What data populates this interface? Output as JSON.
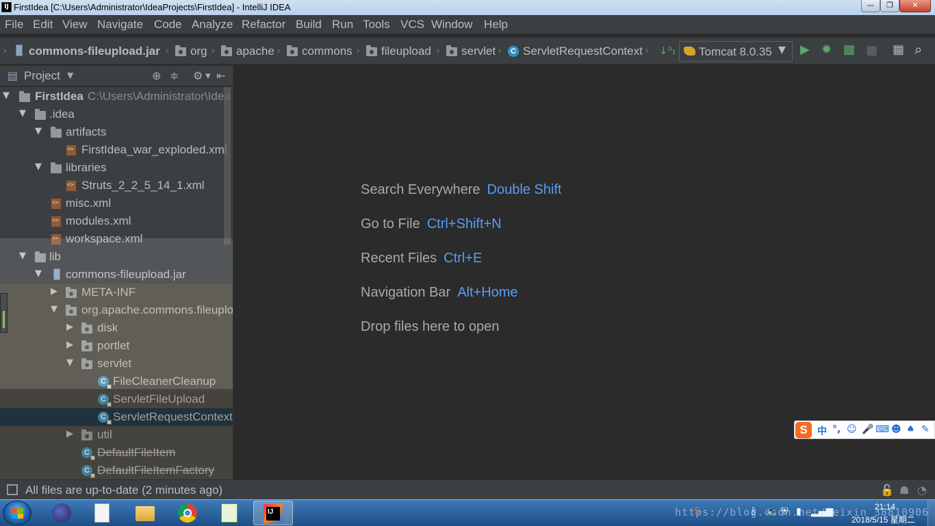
{
  "window": {
    "title": "FirstIdea [C:\\Users\\Administrator\\IdeaProjects\\FirstIdea] - IntelliJ IDEA",
    "app_icon": "IJ",
    "controls": {
      "minimize": "—",
      "maximize": "❐",
      "close": "✕"
    }
  },
  "menu": [
    "File",
    "Edit",
    "View",
    "Navigate",
    "Code",
    "Analyze",
    "Refactor",
    "Build",
    "Run",
    "Tools",
    "VCS",
    "Window",
    "Help"
  ],
  "breadcrumb": [
    "commons-fileupload.jar",
    "org",
    "apache",
    "commons",
    "fileupload",
    "servlet",
    "ServletRequestContext"
  ],
  "run_config": {
    "label": "Tomcat 8.0.35"
  },
  "project_panel": {
    "title": "Project",
    "tree": [
      {
        "label": "FirstIdea",
        "extra": "C:\\Users\\Administrator\\Idea",
        "icon": "project-folder-icon"
      },
      {
        "label": ".idea",
        "icon": "folder-icon"
      },
      {
        "label": "artifacts",
        "icon": "folder-icon"
      },
      {
        "label": "FirstIdea_war_exploded.xml",
        "icon": "xml-file-icon"
      },
      {
        "label": "libraries",
        "icon": "folder-icon"
      },
      {
        "label": "Struts_2_2_5_14_1.xml",
        "icon": "xml-file-icon"
      },
      {
        "label": "misc.xml",
        "icon": "xml-file-icon"
      },
      {
        "label": "modules.xml",
        "icon": "xml-file-icon"
      },
      {
        "label": "workspace.xml",
        "icon": "xml-file-icon"
      },
      {
        "label": "lib",
        "icon": "folder-icon"
      },
      {
        "label": "commons-fileupload.jar",
        "icon": "jar-icon"
      },
      {
        "label": "META-INF",
        "icon": "package-icon"
      },
      {
        "label": "org.apache.commons.fileuplo",
        "icon": "package-icon"
      },
      {
        "label": "disk",
        "icon": "package-icon"
      },
      {
        "label": "portlet",
        "icon": "package-icon"
      },
      {
        "label": "servlet",
        "icon": "package-icon"
      },
      {
        "label": "FileCleanerCleanup",
        "icon": "class-icon"
      },
      {
        "label": "ServletFileUpload",
        "icon": "class-icon"
      },
      {
        "label": "ServletRequestContext",
        "icon": "class-icon",
        "selected": true
      },
      {
        "label": "util",
        "icon": "package-icon"
      },
      {
        "label": "DefaultFileItem",
        "icon": "class-icon",
        "deprecated": true
      },
      {
        "label": "DefaultFileItemFactory",
        "icon": "class-icon",
        "deprecated": true
      }
    ]
  },
  "editor_hints": [
    {
      "text": "Search Everywhere",
      "key": "Double Shift"
    },
    {
      "text": "Go to File",
      "key": "Ctrl+Shift+N"
    },
    {
      "text": "Recent Files",
      "key": "Ctrl+E"
    },
    {
      "text": "Navigation Bar",
      "key": "Alt+Home"
    },
    {
      "text": "Drop files here to open",
      "key": ""
    }
  ],
  "ime": {
    "logo": "S",
    "lang": "中"
  },
  "status": {
    "message": "All files are up-to-date (2 minutes ago)"
  },
  "taskbar": {
    "apps": [
      "eclipse",
      "notepad",
      "explorer",
      "chrome",
      "notepad-plus-plus",
      "intellij-idea"
    ],
    "tray_watermark": "https://blog.csdn.net/weixin_38810906",
    "time": "21:14",
    "date": "2018/5/15 星期二"
  },
  "colors": {
    "accent": "#589df6",
    "selection": "#0d293e",
    "panel_bg": "#3c3f41",
    "editor_bg": "#2b2b2b",
    "run_green": "#59a869"
  }
}
